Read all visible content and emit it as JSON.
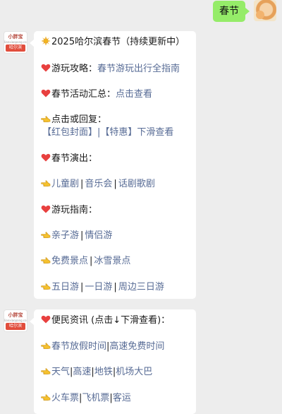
{
  "outgoing": {
    "text": "春节"
  },
  "bot": {
    "brand": "小胖宝",
    "brand_sub": "lianxiaopang.com",
    "city": "哈尔滨"
  },
  "card1": {
    "title": "2025哈尔滨春节（持续更新中）",
    "guide_label": "游玩攻略：",
    "guide_link": "春节游玩出行全指南",
    "events_label": "春节活动汇总：",
    "events_link": "点击查看",
    "reply_label": "点击或回复：",
    "reply_line": "【红包封面】|【特惠】下滑查看",
    "shows_label": "春节演出：",
    "shows_links": [
      "儿童剧",
      "音乐会",
      "话剧歌剧"
    ],
    "tips_label": "游玩指南：",
    "tips_links_1": [
      "亲子游",
      "情侣游"
    ],
    "tips_links_2": [
      "免费景点",
      "冰雪景点"
    ],
    "tips_links_3": [
      "五日游",
      "一日游",
      "周边三日游"
    ]
  },
  "card2": {
    "title": "便民资讯 (点击↓下滑查看)：",
    "links_1": [
      "春节放假时间",
      "高速免费时间"
    ],
    "links_2": [
      "天气",
      "高速",
      "地铁",
      "机场大巴"
    ],
    "links_3": [
      "火车票",
      "飞机票",
      "客运"
    ]
  },
  "separator": "|"
}
